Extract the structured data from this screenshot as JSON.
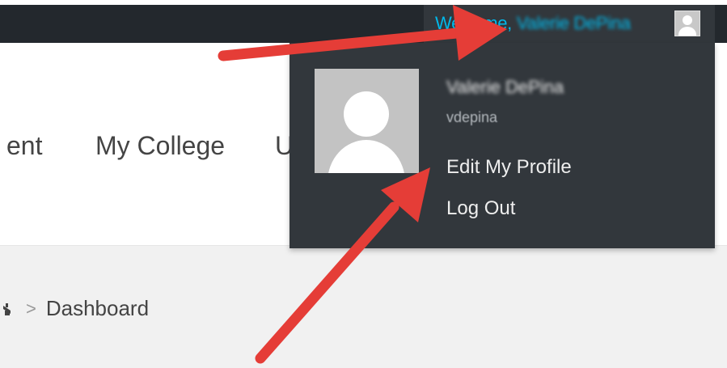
{
  "admin_bar": {
    "welcome_prefix": "Welcome,",
    "user_name": "Valerie DePina"
  },
  "nav": {
    "items": [
      {
        "label": "ent"
      },
      {
        "label": "My College"
      },
      {
        "label": "U"
      }
    ]
  },
  "breadcrumb": {
    "separator": ">",
    "current": "Dashboard"
  },
  "dropdown": {
    "display_name": "Valerie DePina",
    "username": "vdepina",
    "edit_profile_label": "Edit My Profile",
    "logout_label": "Log Out"
  },
  "colors": {
    "admin_bar_bg": "#23282d",
    "dropdown_bg": "#32373c",
    "welcome_link": "#00b9eb",
    "annotation_arrow": "#e53d37"
  },
  "icons": {
    "bar_avatar": "user-avatar-icon",
    "dropdown_avatar": "user-avatar-icon",
    "breadcrumb_home": "home-icon"
  }
}
